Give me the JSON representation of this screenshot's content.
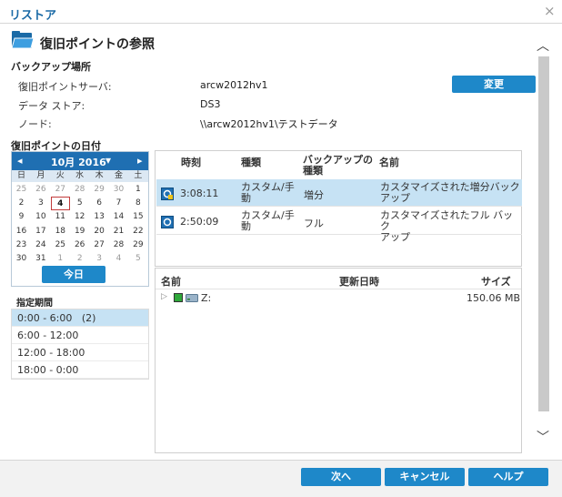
{
  "window": {
    "title": "リストア",
    "close_glyph": "×"
  },
  "header": {
    "title": "復旧ポイントの参照",
    "icon": "folder-open-icon"
  },
  "backup_location": {
    "label": "バックアップ場所",
    "rows": [
      {
        "label": "復旧ポイントサーバ:",
        "value": "arcw2012hv1"
      },
      {
        "label": "データ ストア:",
        "value": "DS3"
      },
      {
        "label": "ノード:",
        "value": "\\\\arcw2012hv1\\テストデータ"
      }
    ],
    "change_label": "変更"
  },
  "recovery_date": {
    "label": "復旧ポイントの日付"
  },
  "calendar": {
    "month_label": "10月 2016",
    "prev_glyph": "◂",
    "next_glyph": "▸",
    "dropdown_glyph": "▾",
    "weekdays": [
      "日",
      "月",
      "火",
      "水",
      "木",
      "金",
      "土"
    ],
    "weeks": [
      [
        "25",
        "26",
        "27",
        "28",
        "29",
        "30",
        "1"
      ],
      [
        "2",
        "3",
        "4",
        "5",
        "6",
        "7",
        "8"
      ],
      [
        "9",
        "10",
        "11",
        "12",
        "13",
        "14",
        "15"
      ],
      [
        "16",
        "17",
        "18",
        "19",
        "20",
        "21",
        "22"
      ],
      [
        "23",
        "24",
        "25",
        "26",
        "27",
        "28",
        "29"
      ],
      [
        "30",
        "31",
        "1",
        "2",
        "3",
        "4",
        "5"
      ]
    ],
    "selected_day": "4",
    "today_label": "今日"
  },
  "time_range": {
    "label": "指定期間",
    "items": [
      "0:00 - 6:00   (2)",
      "6:00 - 12:00",
      "12:00 - 18:00",
      "18:00 - 0:00"
    ],
    "selected_index": 0
  },
  "recovery_points": {
    "columns": [
      "時刻",
      "種類",
      "バックアップの\n種類",
      "名前"
    ],
    "rows": [
      {
        "time": "3:08:11",
        "type": "カスタム/手\n動",
        "backup_type": "増分",
        "name": "カスタマイズされた増分バック\nアップ",
        "icon": "incremental-backup-icon"
      },
      {
        "time": "2:50:09",
        "type": "カスタム/手\n動",
        "backup_type": "フル",
        "name": "カスタマイズされたフル バック\nアップ",
        "icon": "full-backup-icon"
      }
    ],
    "selected_index": 0
  },
  "files": {
    "columns": [
      "名前",
      "更新日時",
      "サイズ"
    ],
    "rows": [
      {
        "expand_glyph": "▷",
        "name": "Z:",
        "date": "",
        "size": "150.06 MB"
      }
    ]
  },
  "scroll": {
    "up_glyph": "︿",
    "down_glyph": "﹀"
  },
  "footer": {
    "next_label": "次へ",
    "cancel_label": "キャンセル",
    "help_label": "ヘルプ"
  },
  "colors": {
    "accent": "#1e88c9",
    "calendar_header": "#1f6fb2",
    "selection": "#c6e2f4",
    "title": "#1a6aa6"
  }
}
